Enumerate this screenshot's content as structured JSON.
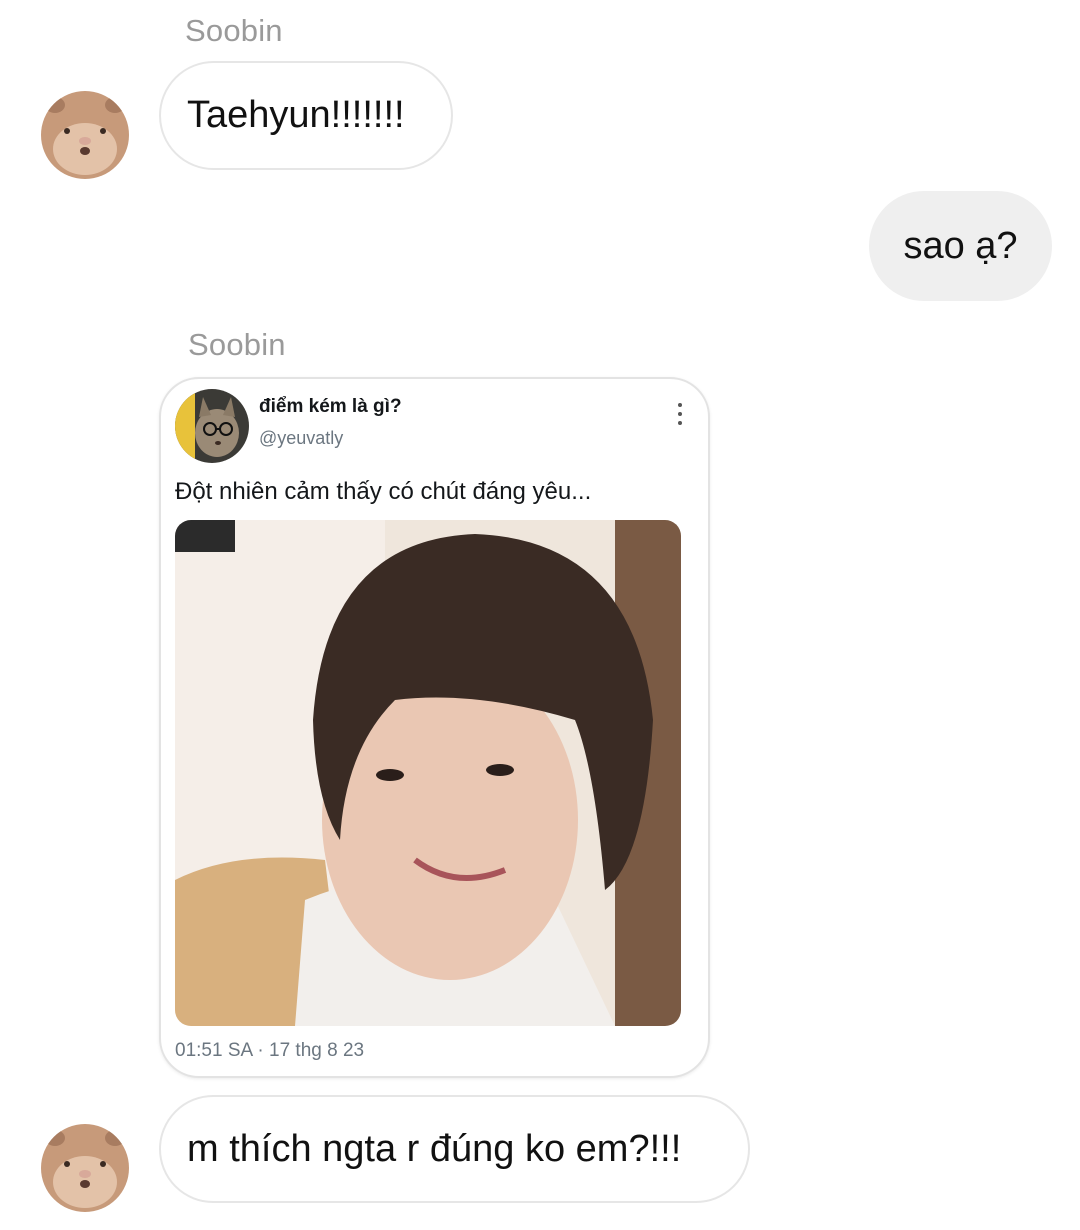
{
  "messages": {
    "m1": {
      "sender": "Soobin",
      "text": "Taehyun!!!!!!!"
    },
    "m2": {
      "text": "sao ạ?"
    },
    "m3": {
      "sender": "Soobin",
      "tweet": {
        "name": "điểm kém là gì?",
        "handle": "@yeuvatly",
        "text": "Đột nhiên cảm thấy có chút đáng yêu...",
        "meta": "01:51 SA · 17 thg 8 23"
      }
    },
    "m4": {
      "text": "m thích ngta r đúng ko em?!!!"
    }
  },
  "icons": {
    "avatar": "hamster-face-avatar",
    "tweet_avatar": "cat-with-glasses-avatar",
    "more": "more-vertical-icon"
  }
}
